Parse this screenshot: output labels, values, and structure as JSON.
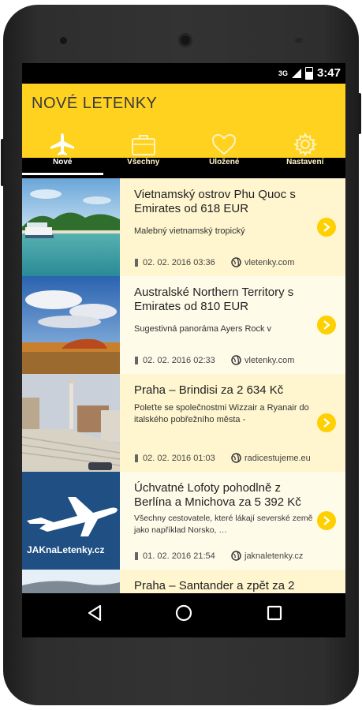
{
  "status": {
    "network": "3G",
    "time": "3:47"
  },
  "app": {
    "title": "NOVÉ LETENKY"
  },
  "tabs": [
    {
      "label": "Nové",
      "icon": "airplane-icon",
      "active": true
    },
    {
      "label": "Všechny",
      "icon": "briefcase-icon",
      "active": false
    },
    {
      "label": "Uložené",
      "icon": "heart-icon",
      "active": false
    },
    {
      "label": "Nastavení",
      "icon": "gear-icon",
      "active": false
    }
  ],
  "items": [
    {
      "title": "Vietnamský ostrov Phu Quoc s Emirates od 618 EUR",
      "desc": "Malebný vietnamský tropický",
      "date": "02. 02. 2016 03:36",
      "source": "vletenky.com"
    },
    {
      "title": "Australské Northern Territory s Emirates od 810 EUR",
      "desc": "Sugestivná panoráma Ayers Rock v",
      "date": "02. 02. 2016 02:33",
      "source": "vletenky.com"
    },
    {
      "title": "Praha – Brindisi za 2 634 Kč",
      "desc": "Poleťte se společnostmi  Wizzair a Ryanair do italského pobřežního města -",
      "date": "02. 02. 2016 01:03",
      "source": "radicestujeme.eu"
    },
    {
      "title": "Úchvatné Lofoty pohodlně z Berlína a Mnichova za 5 392 Kč",
      "desc": "Všechny cestovatele, které lákají severské země jako například Norsko, …",
      "date": "01. 02. 2016 21:54",
      "source": "jaknaletenky.cz",
      "logo_text": "JAKnaLetenky.cz"
    },
    {
      "title": "Praha – Santander a zpět za 2",
      "desc": "",
      "date": "",
      "source": ""
    }
  ],
  "colors": {
    "accent": "#ffd21f",
    "item_bg": "#fff5cf",
    "arrow": "#ffd000"
  }
}
